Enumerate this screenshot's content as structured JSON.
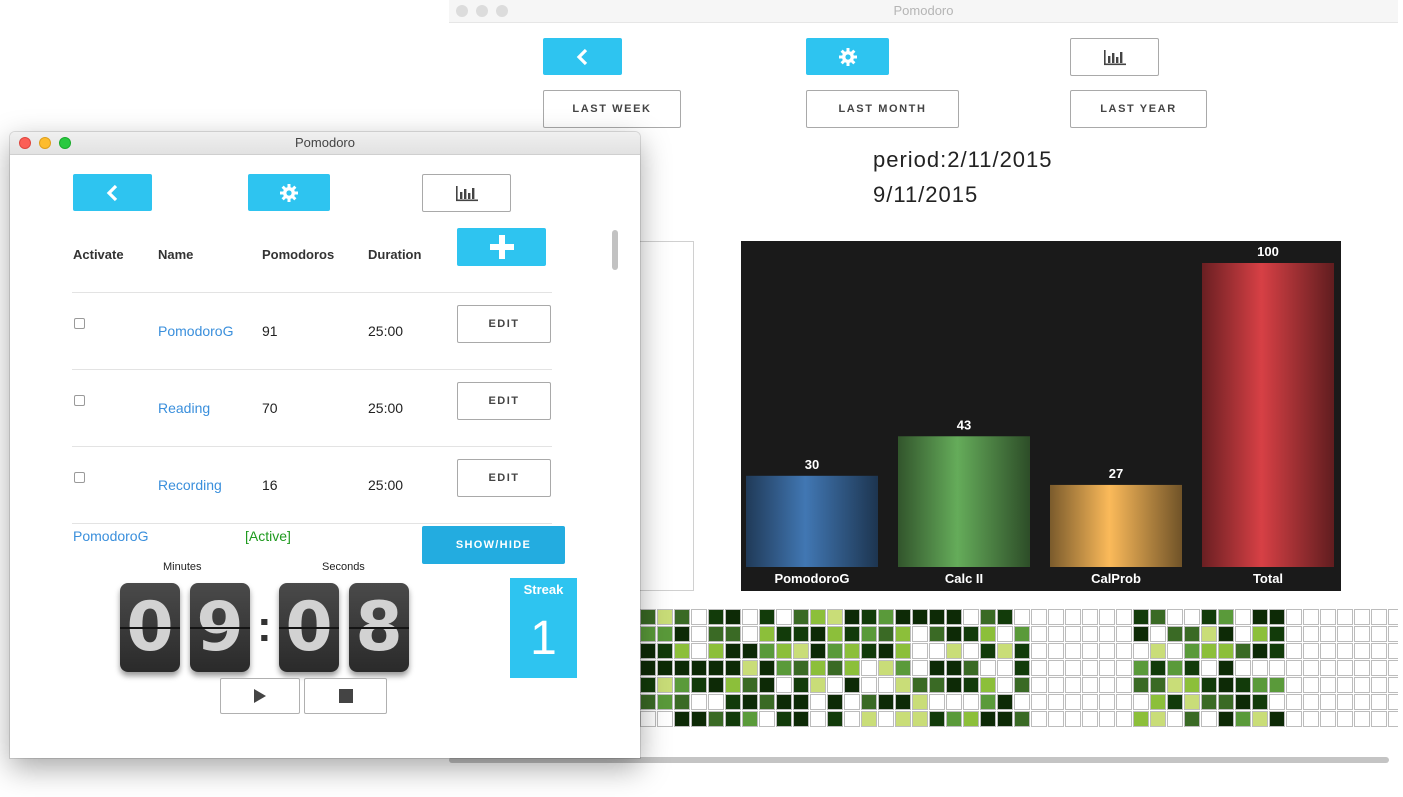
{
  "back_window": {
    "title": "Pomodoro",
    "icons": {
      "back": "chevron-left-icon",
      "settings": "gear-icon",
      "stats": "bar-chart-icon"
    },
    "period_buttons": [
      "LAST WEEK",
      "LAST MONTH",
      "LAST YEAR"
    ],
    "period_line1": "period:2/11/2015",
    "period_line2": "9/11/2015",
    "colors": {
      "accent": "#2ec4f0",
      "chart_bg": "#1a1a1a"
    }
  },
  "chart_data": {
    "type": "bar",
    "categories": [
      "PomodoroG",
      "Calc II",
      "CalProb",
      "Total"
    ],
    "values": [
      30,
      43,
      27,
      100
    ],
    "colors": [
      "#3a6aa0",
      "#5a9a50",
      "#e0a650",
      "#c0393e"
    ],
    "ylim": [
      0,
      100
    ]
  },
  "front_window": {
    "title": "Pomodoro",
    "icons": {
      "back": "chevron-left-icon",
      "settings": "gear-icon",
      "stats": "bar-chart-icon",
      "add": "plus-icon"
    },
    "columns": [
      "Activate",
      "Name",
      "Pomodoros",
      "Duration"
    ],
    "tasks": [
      {
        "name": "PomodoroG",
        "pomodoros": "91",
        "duration": "25:00",
        "edit": "EDIT"
      },
      {
        "name": "Reading",
        "pomodoros": "70",
        "duration": "25:00",
        "edit": "EDIT"
      },
      {
        "name": "Recording",
        "pomodoros": "16",
        "duration": "25:00",
        "edit": "EDIT"
      }
    ],
    "active_task": "PomodoroG",
    "active_status": "[Active]",
    "show_hide": "SHOW/HIDE",
    "timer": {
      "minutes_label": "Minutes",
      "seconds_label": "Seconds",
      "digits": [
        "0",
        "9",
        "0",
        "8"
      ]
    },
    "streak": {
      "label": "Streak",
      "value": "1"
    }
  }
}
